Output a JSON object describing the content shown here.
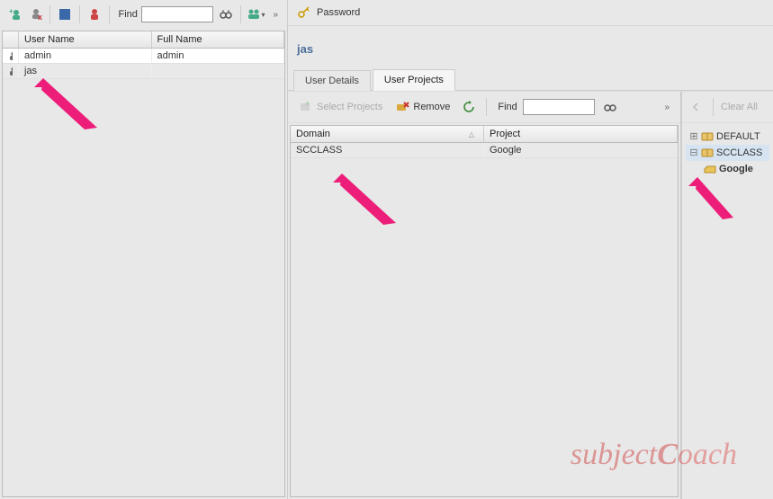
{
  "left_toolbar": {
    "find_label": "Find"
  },
  "users_table": {
    "columns": {
      "user": "User Name",
      "full": "Full Name"
    },
    "rows": [
      {
        "user": "admin",
        "full": "admin",
        "selected": false
      },
      {
        "user": "jas",
        "full": "",
        "selected": true
      }
    ]
  },
  "right": {
    "password_label": "Password",
    "current_user": "jas",
    "tabs": {
      "details": "User Details",
      "projects": "User Projects"
    },
    "projects_toolbar": {
      "select_projects": "Select Projects",
      "remove": "Remove",
      "find_label": "Find"
    },
    "projects_table": {
      "columns": {
        "domain": "Domain",
        "project": "Project"
      },
      "rows": [
        {
          "domain": "SCCLASS",
          "project": "Google"
        }
      ]
    },
    "clear_all": "Clear All",
    "tree": {
      "default": "DEFAULT",
      "scclass": "SCCLASS",
      "google": "Google"
    }
  },
  "watermark": {
    "left": "subject",
    "right": "oach"
  }
}
